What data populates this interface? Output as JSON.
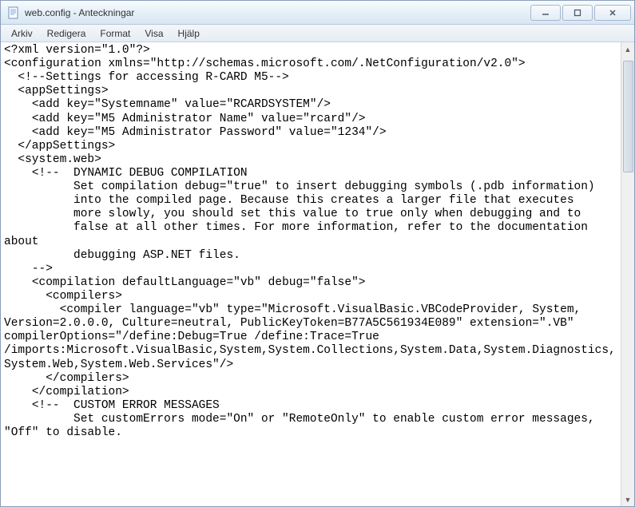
{
  "window": {
    "title": "web.config - Anteckningar"
  },
  "menu": {
    "items": [
      "Arkiv",
      "Redigera",
      "Format",
      "Visa",
      "Hjälp"
    ]
  },
  "content": {
    "text": "<?xml version=\"1.0\"?>\n<configuration xmlns=\"http://schemas.microsoft.com/.NetConfiguration/v2.0\">\n  <!--Settings for accessing R-CARD M5-->\n  <appSettings>\n    <add key=\"Systemname\" value=\"RCARDSYSTEM\"/>\n    <add key=\"M5 Administrator Name\" value=\"rcard\"/>\n    <add key=\"M5 Administrator Password\" value=\"1234\"/>\n  </appSettings>\n  <system.web>\n    <!--  DYNAMIC DEBUG COMPILATION\n          Set compilation debug=\"true\" to insert debugging symbols (.pdb information)\n          into the compiled page. Because this creates a larger file that executes\n          more slowly, you should set this value to true only when debugging and to\n          false at all other times. For more information, refer to the documentation about\n          debugging ASP.NET files.\n    -->\n    <compilation defaultLanguage=\"vb\" debug=\"false\">\n      <compilers>\n        <compiler language=\"vb\" type=\"Microsoft.VisualBasic.VBCodeProvider, System, Version=2.0.0.0, Culture=neutral, PublicKeyToken=B77A5C561934E089\" extension=\".VB\" compilerOptions=\"/define:Debug=True /define:Trace=True /imports:Microsoft.VisualBasic,System,System.Collections,System.Data,System.Diagnostics,System.Web,System.Web.Services\"/>\n      </compilers>\n    </compilation>\n    <!--  CUSTOM ERROR MESSAGES\n          Set customErrors mode=\"On\" or \"RemoteOnly\" to enable custom error messages, \"Off\" to disable."
  }
}
